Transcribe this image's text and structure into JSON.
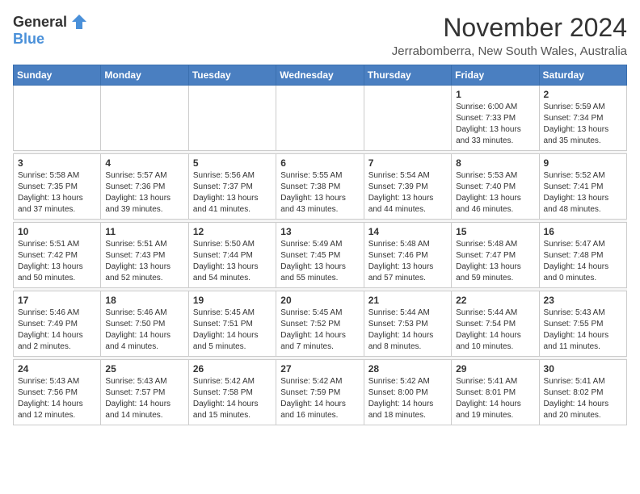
{
  "logo": {
    "general": "General",
    "blue": "Blue"
  },
  "title": "November 2024",
  "location": "Jerrabomberra, New South Wales, Australia",
  "weekdays": [
    "Sunday",
    "Monday",
    "Tuesday",
    "Wednesday",
    "Thursday",
    "Friday",
    "Saturday"
  ],
  "weeks": [
    [
      {
        "day": "",
        "sunrise": "",
        "sunset": "",
        "daylight": ""
      },
      {
        "day": "",
        "sunrise": "",
        "sunset": "",
        "daylight": ""
      },
      {
        "day": "",
        "sunrise": "",
        "sunset": "",
        "daylight": ""
      },
      {
        "day": "",
        "sunrise": "",
        "sunset": "",
        "daylight": ""
      },
      {
        "day": "",
        "sunrise": "",
        "sunset": "",
        "daylight": ""
      },
      {
        "day": "1",
        "sunrise": "Sunrise: 6:00 AM",
        "sunset": "Sunset: 7:33 PM",
        "daylight": "Daylight: 13 hours and 33 minutes."
      },
      {
        "day": "2",
        "sunrise": "Sunrise: 5:59 AM",
        "sunset": "Sunset: 7:34 PM",
        "daylight": "Daylight: 13 hours and 35 minutes."
      }
    ],
    [
      {
        "day": "3",
        "sunrise": "Sunrise: 5:58 AM",
        "sunset": "Sunset: 7:35 PM",
        "daylight": "Daylight: 13 hours and 37 minutes."
      },
      {
        "day": "4",
        "sunrise": "Sunrise: 5:57 AM",
        "sunset": "Sunset: 7:36 PM",
        "daylight": "Daylight: 13 hours and 39 minutes."
      },
      {
        "day": "5",
        "sunrise": "Sunrise: 5:56 AM",
        "sunset": "Sunset: 7:37 PM",
        "daylight": "Daylight: 13 hours and 41 minutes."
      },
      {
        "day": "6",
        "sunrise": "Sunrise: 5:55 AM",
        "sunset": "Sunset: 7:38 PM",
        "daylight": "Daylight: 13 hours and 43 minutes."
      },
      {
        "day": "7",
        "sunrise": "Sunrise: 5:54 AM",
        "sunset": "Sunset: 7:39 PM",
        "daylight": "Daylight: 13 hours and 44 minutes."
      },
      {
        "day": "8",
        "sunrise": "Sunrise: 5:53 AM",
        "sunset": "Sunset: 7:40 PM",
        "daylight": "Daylight: 13 hours and 46 minutes."
      },
      {
        "day": "9",
        "sunrise": "Sunrise: 5:52 AM",
        "sunset": "Sunset: 7:41 PM",
        "daylight": "Daylight: 13 hours and 48 minutes."
      }
    ],
    [
      {
        "day": "10",
        "sunrise": "Sunrise: 5:51 AM",
        "sunset": "Sunset: 7:42 PM",
        "daylight": "Daylight: 13 hours and 50 minutes."
      },
      {
        "day": "11",
        "sunrise": "Sunrise: 5:51 AM",
        "sunset": "Sunset: 7:43 PM",
        "daylight": "Daylight: 13 hours and 52 minutes."
      },
      {
        "day": "12",
        "sunrise": "Sunrise: 5:50 AM",
        "sunset": "Sunset: 7:44 PM",
        "daylight": "Daylight: 13 hours and 54 minutes."
      },
      {
        "day": "13",
        "sunrise": "Sunrise: 5:49 AM",
        "sunset": "Sunset: 7:45 PM",
        "daylight": "Daylight: 13 hours and 55 minutes."
      },
      {
        "day": "14",
        "sunrise": "Sunrise: 5:48 AM",
        "sunset": "Sunset: 7:46 PM",
        "daylight": "Daylight: 13 hours and 57 minutes."
      },
      {
        "day": "15",
        "sunrise": "Sunrise: 5:48 AM",
        "sunset": "Sunset: 7:47 PM",
        "daylight": "Daylight: 13 hours and 59 minutes."
      },
      {
        "day": "16",
        "sunrise": "Sunrise: 5:47 AM",
        "sunset": "Sunset: 7:48 PM",
        "daylight": "Daylight: 14 hours and 0 minutes."
      }
    ],
    [
      {
        "day": "17",
        "sunrise": "Sunrise: 5:46 AM",
        "sunset": "Sunset: 7:49 PM",
        "daylight": "Daylight: 14 hours and 2 minutes."
      },
      {
        "day": "18",
        "sunrise": "Sunrise: 5:46 AM",
        "sunset": "Sunset: 7:50 PM",
        "daylight": "Daylight: 14 hours and 4 minutes."
      },
      {
        "day": "19",
        "sunrise": "Sunrise: 5:45 AM",
        "sunset": "Sunset: 7:51 PM",
        "daylight": "Daylight: 14 hours and 5 minutes."
      },
      {
        "day": "20",
        "sunrise": "Sunrise: 5:45 AM",
        "sunset": "Sunset: 7:52 PM",
        "daylight": "Daylight: 14 hours and 7 minutes."
      },
      {
        "day": "21",
        "sunrise": "Sunrise: 5:44 AM",
        "sunset": "Sunset: 7:53 PM",
        "daylight": "Daylight: 14 hours and 8 minutes."
      },
      {
        "day": "22",
        "sunrise": "Sunrise: 5:44 AM",
        "sunset": "Sunset: 7:54 PM",
        "daylight": "Daylight: 14 hours and 10 minutes."
      },
      {
        "day": "23",
        "sunrise": "Sunrise: 5:43 AM",
        "sunset": "Sunset: 7:55 PM",
        "daylight": "Daylight: 14 hours and 11 minutes."
      }
    ],
    [
      {
        "day": "24",
        "sunrise": "Sunrise: 5:43 AM",
        "sunset": "Sunset: 7:56 PM",
        "daylight": "Daylight: 14 hours and 12 minutes."
      },
      {
        "day": "25",
        "sunrise": "Sunrise: 5:43 AM",
        "sunset": "Sunset: 7:57 PM",
        "daylight": "Daylight: 14 hours and 14 minutes."
      },
      {
        "day": "26",
        "sunrise": "Sunrise: 5:42 AM",
        "sunset": "Sunset: 7:58 PM",
        "daylight": "Daylight: 14 hours and 15 minutes."
      },
      {
        "day": "27",
        "sunrise": "Sunrise: 5:42 AM",
        "sunset": "Sunset: 7:59 PM",
        "daylight": "Daylight: 14 hours and 16 minutes."
      },
      {
        "day": "28",
        "sunrise": "Sunrise: 5:42 AM",
        "sunset": "Sunset: 8:00 PM",
        "daylight": "Daylight: 14 hours and 18 minutes."
      },
      {
        "day": "29",
        "sunrise": "Sunrise: 5:41 AM",
        "sunset": "Sunset: 8:01 PM",
        "daylight": "Daylight: 14 hours and 19 minutes."
      },
      {
        "day": "30",
        "sunrise": "Sunrise: 5:41 AM",
        "sunset": "Sunset: 8:02 PM",
        "daylight": "Daylight: 14 hours and 20 minutes."
      }
    ]
  ]
}
